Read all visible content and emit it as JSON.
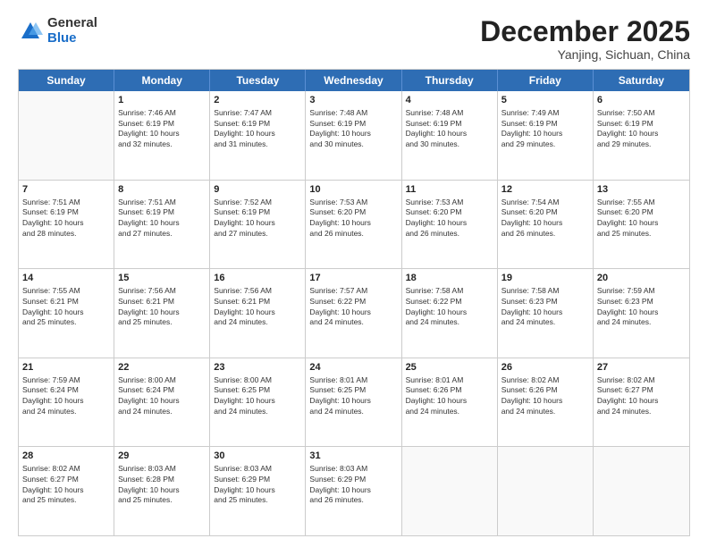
{
  "logo": {
    "general": "General",
    "blue": "Blue"
  },
  "header": {
    "month": "December 2025",
    "location": "Yanjing, Sichuan, China"
  },
  "weekdays": [
    "Sunday",
    "Monday",
    "Tuesday",
    "Wednesday",
    "Thursday",
    "Friday",
    "Saturday"
  ],
  "rows": [
    [
      {
        "day": "",
        "info": ""
      },
      {
        "day": "1",
        "info": "Sunrise: 7:46 AM\nSunset: 6:19 PM\nDaylight: 10 hours\nand 32 minutes."
      },
      {
        "day": "2",
        "info": "Sunrise: 7:47 AM\nSunset: 6:19 PM\nDaylight: 10 hours\nand 31 minutes."
      },
      {
        "day": "3",
        "info": "Sunrise: 7:48 AM\nSunset: 6:19 PM\nDaylight: 10 hours\nand 30 minutes."
      },
      {
        "day": "4",
        "info": "Sunrise: 7:48 AM\nSunset: 6:19 PM\nDaylight: 10 hours\nand 30 minutes."
      },
      {
        "day": "5",
        "info": "Sunrise: 7:49 AM\nSunset: 6:19 PM\nDaylight: 10 hours\nand 29 minutes."
      },
      {
        "day": "6",
        "info": "Sunrise: 7:50 AM\nSunset: 6:19 PM\nDaylight: 10 hours\nand 29 minutes."
      }
    ],
    [
      {
        "day": "7",
        "info": "Sunrise: 7:51 AM\nSunset: 6:19 PM\nDaylight: 10 hours\nand 28 minutes."
      },
      {
        "day": "8",
        "info": "Sunrise: 7:51 AM\nSunset: 6:19 PM\nDaylight: 10 hours\nand 27 minutes."
      },
      {
        "day": "9",
        "info": "Sunrise: 7:52 AM\nSunset: 6:19 PM\nDaylight: 10 hours\nand 27 minutes."
      },
      {
        "day": "10",
        "info": "Sunrise: 7:53 AM\nSunset: 6:20 PM\nDaylight: 10 hours\nand 26 minutes."
      },
      {
        "day": "11",
        "info": "Sunrise: 7:53 AM\nSunset: 6:20 PM\nDaylight: 10 hours\nand 26 minutes."
      },
      {
        "day": "12",
        "info": "Sunrise: 7:54 AM\nSunset: 6:20 PM\nDaylight: 10 hours\nand 26 minutes."
      },
      {
        "day": "13",
        "info": "Sunrise: 7:55 AM\nSunset: 6:20 PM\nDaylight: 10 hours\nand 25 minutes."
      }
    ],
    [
      {
        "day": "14",
        "info": "Sunrise: 7:55 AM\nSunset: 6:21 PM\nDaylight: 10 hours\nand 25 minutes."
      },
      {
        "day": "15",
        "info": "Sunrise: 7:56 AM\nSunset: 6:21 PM\nDaylight: 10 hours\nand 25 minutes."
      },
      {
        "day": "16",
        "info": "Sunrise: 7:56 AM\nSunset: 6:21 PM\nDaylight: 10 hours\nand 24 minutes."
      },
      {
        "day": "17",
        "info": "Sunrise: 7:57 AM\nSunset: 6:22 PM\nDaylight: 10 hours\nand 24 minutes."
      },
      {
        "day": "18",
        "info": "Sunrise: 7:58 AM\nSunset: 6:22 PM\nDaylight: 10 hours\nand 24 minutes."
      },
      {
        "day": "19",
        "info": "Sunrise: 7:58 AM\nSunset: 6:23 PM\nDaylight: 10 hours\nand 24 minutes."
      },
      {
        "day": "20",
        "info": "Sunrise: 7:59 AM\nSunset: 6:23 PM\nDaylight: 10 hours\nand 24 minutes."
      }
    ],
    [
      {
        "day": "21",
        "info": "Sunrise: 7:59 AM\nSunset: 6:24 PM\nDaylight: 10 hours\nand 24 minutes."
      },
      {
        "day": "22",
        "info": "Sunrise: 8:00 AM\nSunset: 6:24 PM\nDaylight: 10 hours\nand 24 minutes."
      },
      {
        "day": "23",
        "info": "Sunrise: 8:00 AM\nSunset: 6:25 PM\nDaylight: 10 hours\nand 24 minutes."
      },
      {
        "day": "24",
        "info": "Sunrise: 8:01 AM\nSunset: 6:25 PM\nDaylight: 10 hours\nand 24 minutes."
      },
      {
        "day": "25",
        "info": "Sunrise: 8:01 AM\nSunset: 6:26 PM\nDaylight: 10 hours\nand 24 minutes."
      },
      {
        "day": "26",
        "info": "Sunrise: 8:02 AM\nSunset: 6:26 PM\nDaylight: 10 hours\nand 24 minutes."
      },
      {
        "day": "27",
        "info": "Sunrise: 8:02 AM\nSunset: 6:27 PM\nDaylight: 10 hours\nand 24 minutes."
      }
    ],
    [
      {
        "day": "28",
        "info": "Sunrise: 8:02 AM\nSunset: 6:27 PM\nDaylight: 10 hours\nand 25 minutes."
      },
      {
        "day": "29",
        "info": "Sunrise: 8:03 AM\nSunset: 6:28 PM\nDaylight: 10 hours\nand 25 minutes."
      },
      {
        "day": "30",
        "info": "Sunrise: 8:03 AM\nSunset: 6:29 PM\nDaylight: 10 hours\nand 25 minutes."
      },
      {
        "day": "31",
        "info": "Sunrise: 8:03 AM\nSunset: 6:29 PM\nDaylight: 10 hours\nand 26 minutes."
      },
      {
        "day": "",
        "info": ""
      },
      {
        "day": "",
        "info": ""
      },
      {
        "day": "",
        "info": ""
      }
    ]
  ]
}
